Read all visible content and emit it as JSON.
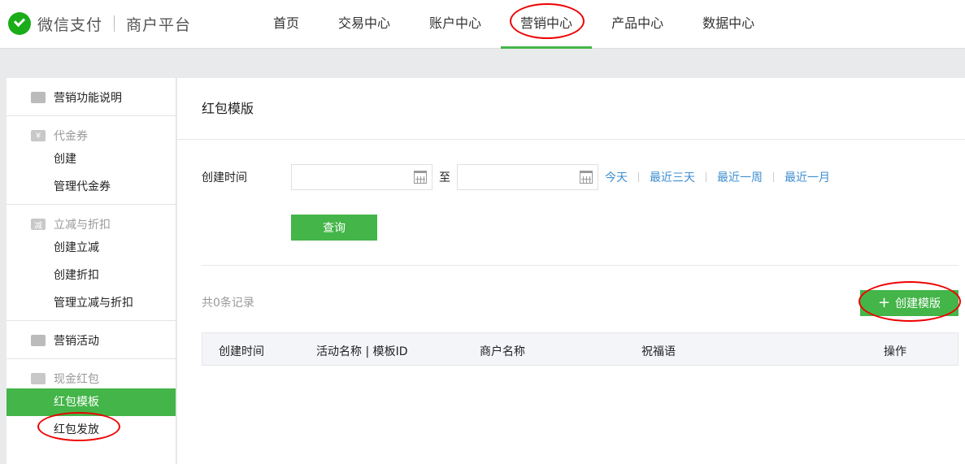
{
  "header": {
    "brand": "微信支付",
    "product": "商户平台",
    "nav": [
      {
        "label": "首页"
      },
      {
        "label": "交易中心"
      },
      {
        "label": "账户中心"
      },
      {
        "label": "营销中心"
      },
      {
        "label": "产品中心"
      },
      {
        "label": "数据中心"
      }
    ],
    "active_nav": "营销中心"
  },
  "sidebar": {
    "groups": [
      {
        "title": "营销功能说明",
        "icon": "book-icon",
        "items": []
      },
      {
        "title": "代金券",
        "icon": "yen-icon",
        "items": [
          "创建",
          "管理代金券"
        ]
      },
      {
        "title": "立减与折扣",
        "icon": "minus-badge-icon",
        "icon_text": "减",
        "items": [
          "创建立减",
          "创建折扣",
          "管理立减与折扣"
        ]
      },
      {
        "title": "营销活动",
        "icon": "gift-icon",
        "items": []
      },
      {
        "title": "现金红包",
        "icon": "red-packet-icon",
        "items": [
          "红包模板",
          "红包发放"
        ]
      }
    ],
    "active_item": "红包模板"
  },
  "main": {
    "title": "红包模版",
    "filter": {
      "label": "创建时间",
      "start_placeholder": "",
      "end_placeholder": "",
      "to": "至",
      "quick": [
        "今天",
        "最近三天",
        "最近一周",
        "最近一月"
      ],
      "query_button": "查询"
    },
    "record_count": "共0条记录",
    "create_button": "创建模版",
    "table": {
      "columns": [
        "创建时间",
        "活动名称 | 模板ID",
        "商户名称",
        "祝福语",
        "操作"
      ],
      "rows": []
    }
  },
  "colors": {
    "accent": "#44b549",
    "link": "#3e8ed0",
    "annotation": "#e00000"
  }
}
